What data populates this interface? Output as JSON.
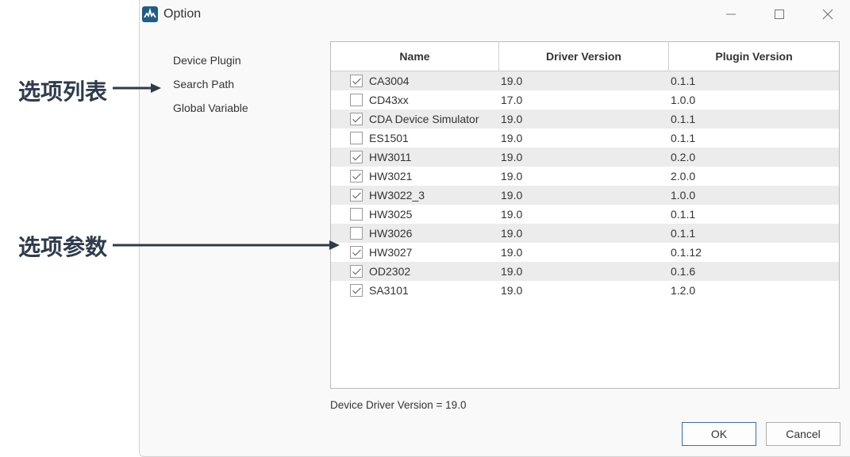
{
  "window": {
    "title": "Option",
    "controls": {
      "minimize": "minimize-icon",
      "maximize": "maximize-icon",
      "close": "close-icon"
    }
  },
  "options_list": {
    "items": [
      "Device Plugin",
      "Search Path",
      "Global Variable"
    ]
  },
  "table": {
    "columns": [
      "Name",
      "Driver Version",
      "Plugin Version"
    ],
    "rows": [
      {
        "checked": true,
        "name": "CA3004",
        "driver": "19.0",
        "plugin": "0.1.1"
      },
      {
        "checked": false,
        "name": "CD43xx",
        "driver": "17.0",
        "plugin": "1.0.0"
      },
      {
        "checked": true,
        "name": "CDA Device Simulator",
        "driver": "19.0",
        "plugin": "0.1.1"
      },
      {
        "checked": false,
        "name": "ES1501",
        "driver": "19.0",
        "plugin": "0.1.1"
      },
      {
        "checked": true,
        "name": "HW3011",
        "driver": "19.0",
        "plugin": "0.2.0"
      },
      {
        "checked": true,
        "name": "HW3021",
        "driver": "19.0",
        "plugin": "2.0.0"
      },
      {
        "checked": true,
        "name": "HW3022_3",
        "driver": "19.0",
        "plugin": "1.0.0"
      },
      {
        "checked": false,
        "name": "HW3025",
        "driver": "19.0",
        "plugin": "0.1.1"
      },
      {
        "checked": false,
        "name": "HW3026",
        "driver": "19.0",
        "plugin": "0.1.1"
      },
      {
        "checked": true,
        "name": "HW3027",
        "driver": "19.0",
        "plugin": "0.1.12"
      },
      {
        "checked": true,
        "name": "OD2302",
        "driver": "19.0",
        "plugin": "0.1.6"
      },
      {
        "checked": true,
        "name": "SA3101",
        "driver": "19.0",
        "plugin": "1.2.0"
      }
    ]
  },
  "footer": {
    "driver_version_text": "Device Driver Version = 19.0"
  },
  "buttons": {
    "ok": "OK",
    "cancel": "Cancel"
  },
  "annotations": {
    "options_list_label": "选项列表",
    "options_params_label": "选项参数"
  },
  "colors": {
    "accent": "#3a6ea5",
    "app_icon": "#1f5c86",
    "annotation": "#2f3b4c"
  }
}
